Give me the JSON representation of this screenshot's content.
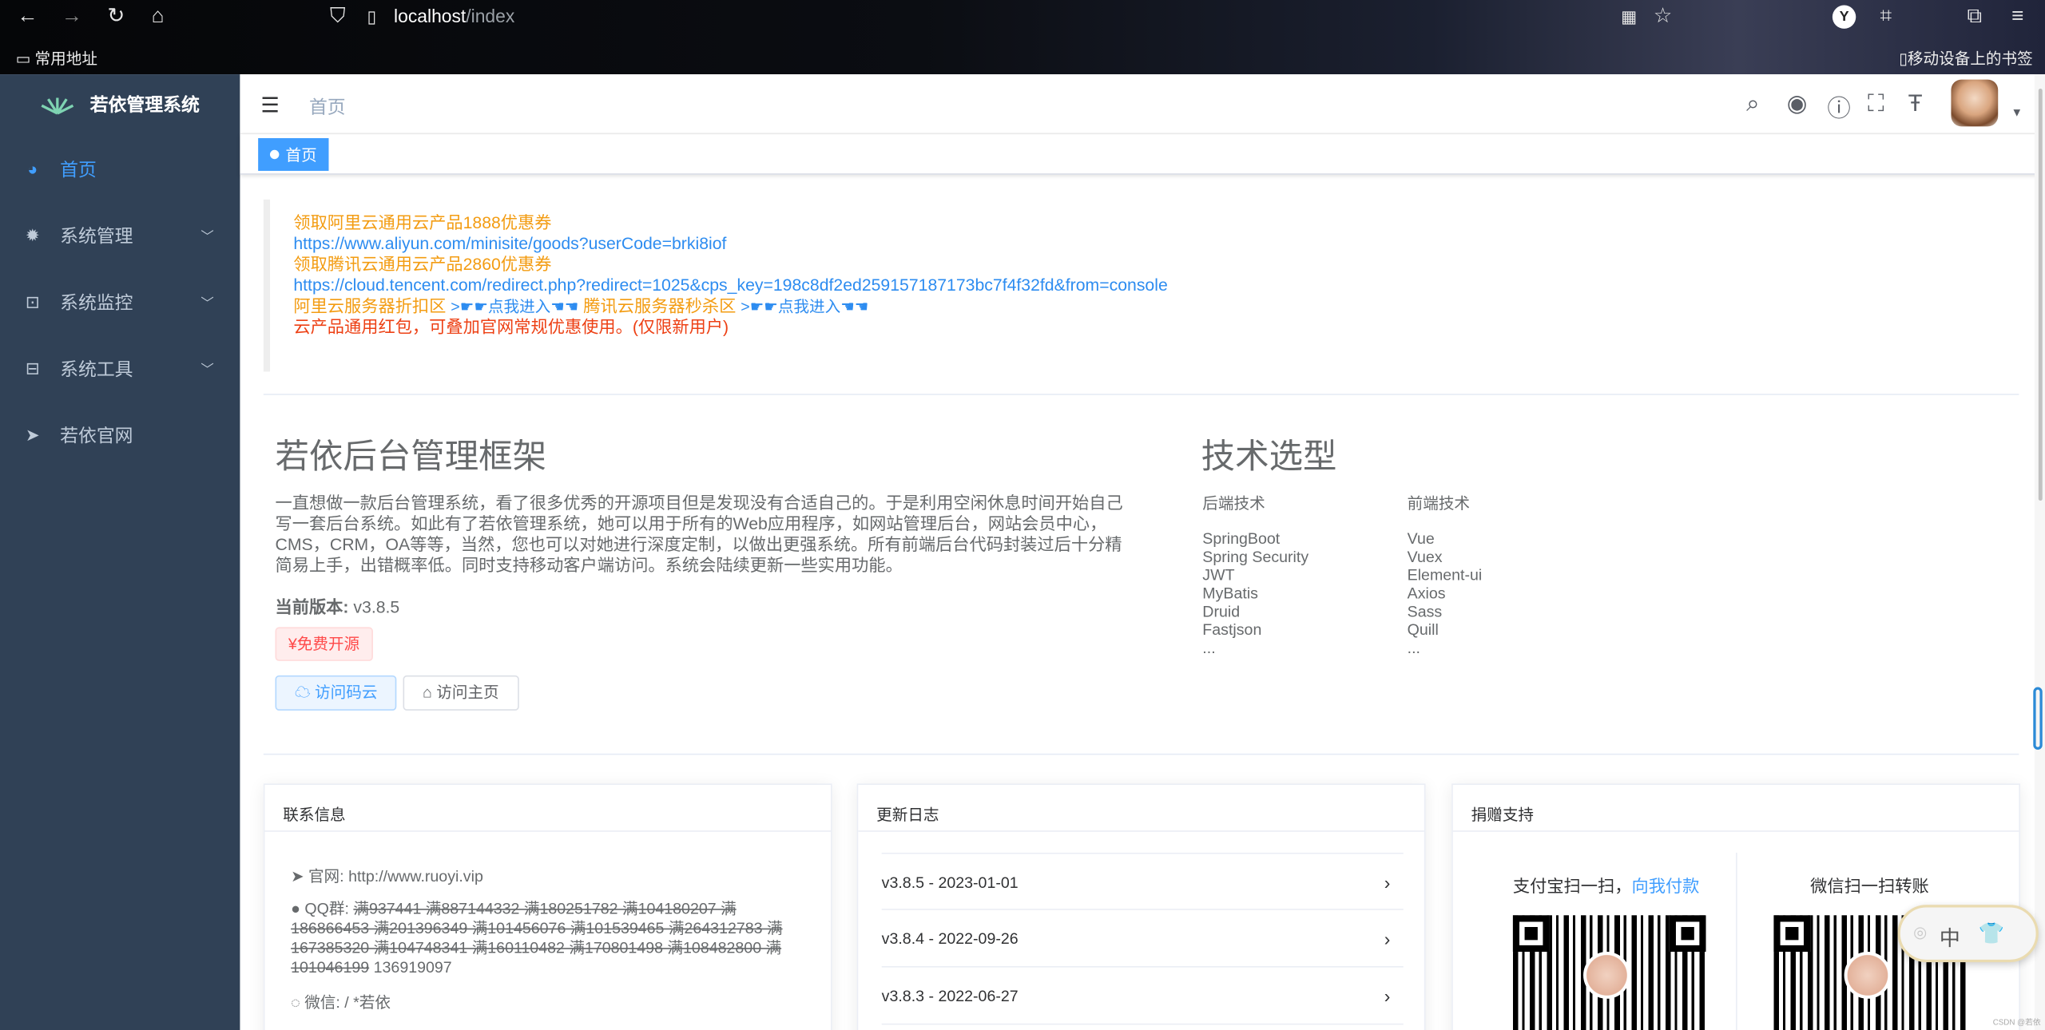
{
  "browser": {
    "url_host": "localhost",
    "url_path": "/index",
    "bookmark_folder": "常用地址",
    "mobile_bookmarks": "移动设备上的书签"
  },
  "sidebar": {
    "title": "若依管理系统",
    "items": [
      {
        "label": "首页",
        "icon": "dashboard-icon",
        "active": true
      },
      {
        "label": "系统管理",
        "icon": "gear-icon"
      },
      {
        "label": "系统监控",
        "icon": "monitor-icon"
      },
      {
        "label": "系统工具",
        "icon": "toolbox-icon"
      },
      {
        "label": "若依官网",
        "icon": "paper-plane-icon"
      }
    ]
  },
  "navbar": {
    "breadcrumb": "首页"
  },
  "tags": {
    "active": "首页"
  },
  "promo": {
    "line1": "领取阿里云通用云产品1888优惠券",
    "line2": "https://www.aliyun.com/minisite/goods?userCode=brki8iof",
    "line3": "领取腾讯云通用云产品2860优惠券",
    "line4": "https://cloud.tencent.com/redirect.php?redirect=1025&cps_key=198c8df2ed259157187173bc7f4f32fd&from=console",
    "ali_zone": "阿里云服务器折扣区",
    "enter1": ">☛☛点我进入☚☚",
    "tx_zone": "腾讯云服务器秒杀区",
    "enter2": ">☛☛点我进入☚☚",
    "line6": "云产品通用红包，可叠加官网常规优惠使用。(仅限新用户)"
  },
  "intro": {
    "title": "若依后台管理框架",
    "text": "一直想做一款后台管理系统，看了很多优秀的开源项目但是发现没有合适自己的。于是利用空闲休息时间开始自己写一套后台系统。如此有了若依管理系统，她可以用于所有的Web应用程序，如网站管理后台，网站会员中心，CMS，CRM，OA等等，当然，您也可以对她进行深度定制，以做出更强系统。所有前端后台代码封装过后十分精简易上手，出错概率低。同时支持移动客户端访问。系统会陆续更新一些实用功能。",
    "version_label": "当前版本:",
    "version": "v3.8.5",
    "free_tag": "¥免费开源",
    "btn_gitee": "访问码云",
    "btn_home": "访问主页"
  },
  "tech": {
    "title": "技术选型",
    "backend_title": "后端技术",
    "frontend_title": "前端技术",
    "backend": [
      "SpringBoot",
      "Spring Security",
      "JWT",
      "MyBatis",
      "Druid",
      "Fastjson",
      "..."
    ],
    "frontend": [
      "Vue",
      "Vuex",
      "Element-ui",
      "Axios",
      "Sass",
      "Quill",
      "..."
    ]
  },
  "contact": {
    "title": "联系信息",
    "site_label": "官网:",
    "site": "http://www.ruoyi.vip",
    "qq_label": "QQ群:",
    "qq_groups_full": "满937441 满887144332 满180251782 满104180207 满186866453 满201396349 满101456076 满101539465 满264312783 满167385320 满104748341 满160110482 满170801498 满108482800 满101046199",
    "qq_open": "136919097",
    "wechat_label": "微信:",
    "wechat": "/ *若依"
  },
  "changelog": {
    "title": "更新日志",
    "items": [
      "v3.8.5 - 2023-01-01",
      "v3.8.4 - 2022-09-26",
      "v3.8.3 - 2022-06-27"
    ]
  },
  "donate": {
    "title": "捐赠支持",
    "alipay": "支付宝扫一扫，",
    "alipay_link": "向我付款",
    "wechat": "微信扫一扫转账"
  },
  "ime": {
    "label": "中"
  },
  "watermark": "CSDN @若依"
}
